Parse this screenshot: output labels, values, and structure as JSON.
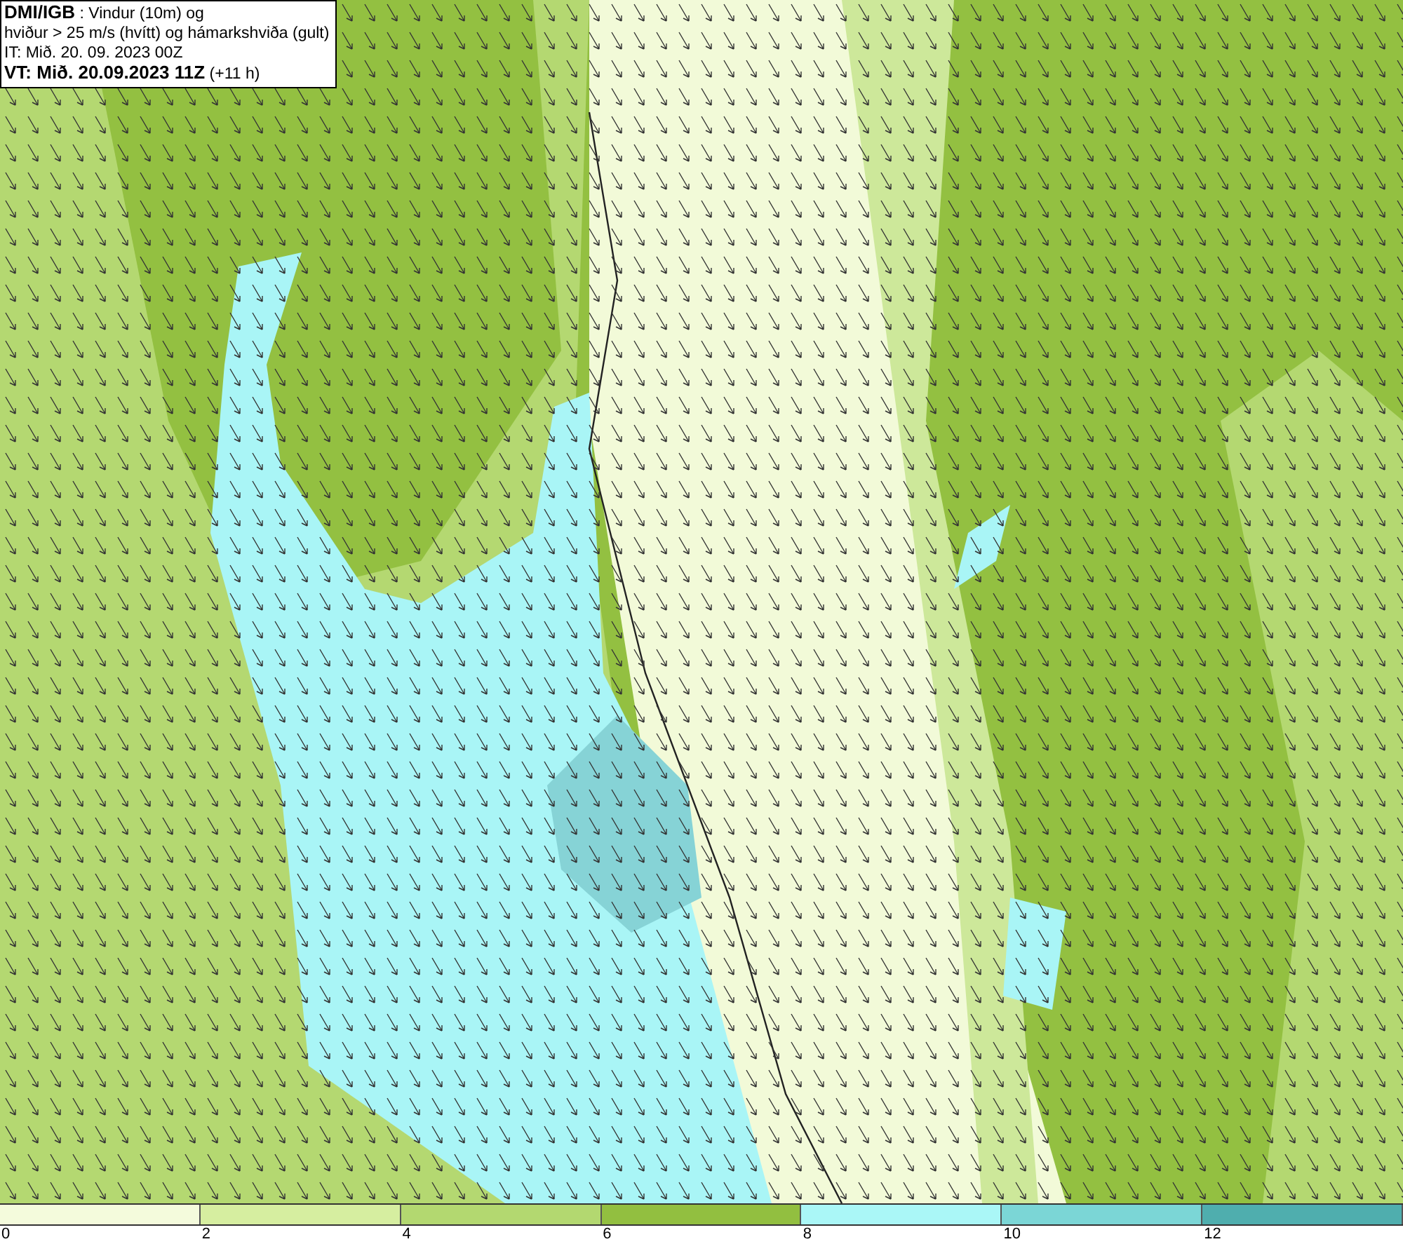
{
  "header": {
    "lines": [
      "**DMI/IGB** : Vindur (10m) og",
      "hviður > 25 m/s (hvítt) og hámarkshviða (gult)",
      "IT: Mið. 20. 09. 2023 00Z",
      "**VT: Mið. 20.09.2023 11Z** (+11 h)"
    ]
  },
  "legend": {
    "bins": [
      {
        "color": "#f4fbdc",
        "label": "0"
      },
      {
        "color": "#d6eea0",
        "label": "2"
      },
      {
        "color": "#b3d870",
        "label": "4"
      },
      {
        "color": "#92bf40",
        "label": "6"
      },
      {
        "color": "#aaf7f7",
        "label": "8"
      },
      {
        "color": "#7bd6d6",
        "label": "10"
      },
      {
        "color": "#4faeae",
        "label": "12"
      }
    ]
  }
}
